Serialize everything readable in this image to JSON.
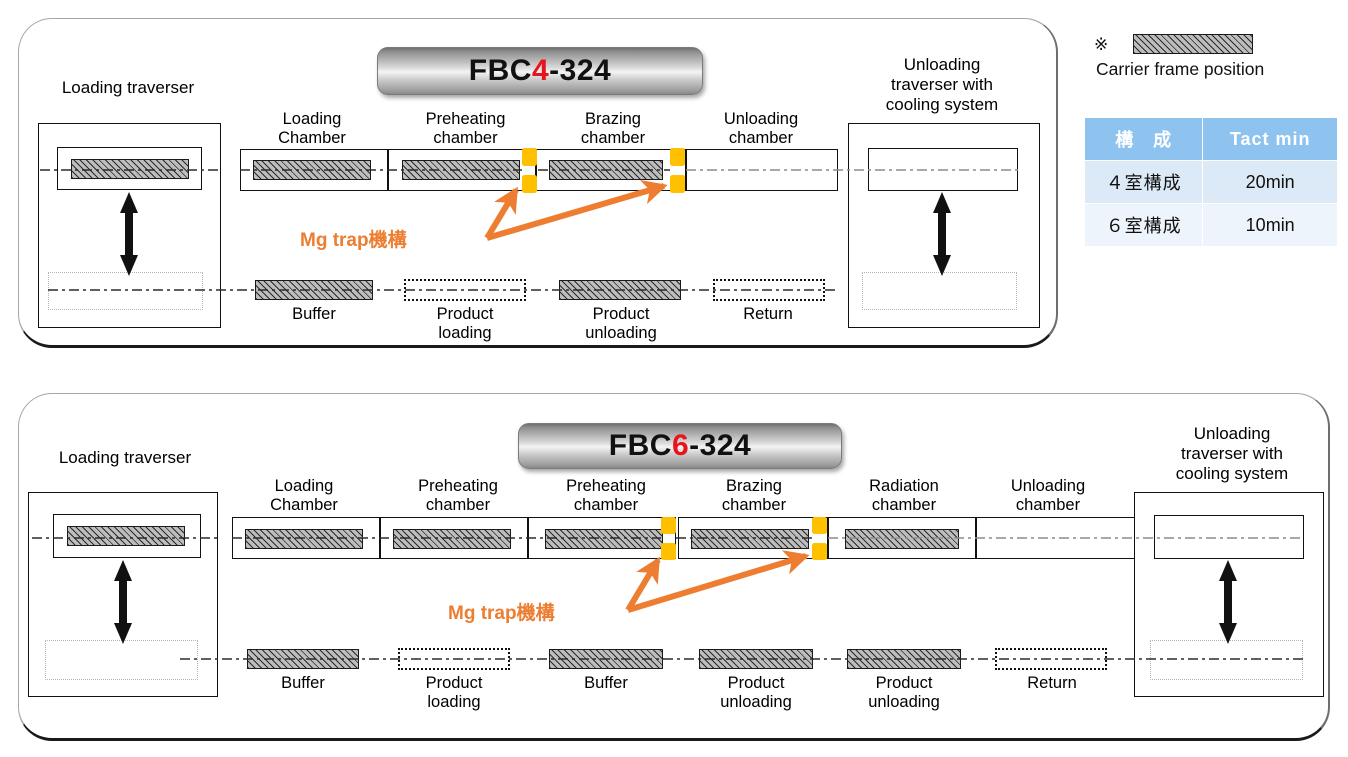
{
  "legend": {
    "mark": "※",
    "caption": "Carrier frame position"
  },
  "tact_table": {
    "headers": [
      "構　成",
      "Tact  min"
    ],
    "rows": [
      {
        "config": "４室構成",
        "tact": "20min"
      },
      {
        "config": "６室構成",
        "tact": "10min"
      }
    ]
  },
  "panels": [
    {
      "id": "fbc4",
      "title_prefix": "FBC",
      "title_number": "4",
      "title_suffix": "-324",
      "loading_traverser_label": "Loading traverser",
      "unloading_traverser_label": "Unloading\ntraverser with\ncooling system",
      "mg_trap_label": "Mg trap機構",
      "chambers": [
        {
          "label": "Loading\nChamber",
          "carrier": true
        },
        {
          "label": "Preheating\nchamber",
          "carrier": true
        },
        {
          "label": "Brazing\nchamber",
          "carrier": true
        },
        {
          "label": "Unloading\nchamber",
          "carrier": false
        }
      ],
      "lower_stations": [
        {
          "label": "Buffer",
          "carrier": true
        },
        {
          "label": "Product\nloading",
          "carrier": false
        },
        {
          "label": "Product\nunloading",
          "carrier": true
        },
        {
          "label": "Return",
          "carrier": false
        }
      ]
    },
    {
      "id": "fbc6",
      "title_prefix": "FBC",
      "title_number": "6",
      "title_suffix": "-324",
      "loading_traverser_label": "Loading traverser",
      "unloading_traverser_label": "Unloading\ntraverser with\ncooling system",
      "mg_trap_label": "Mg trap機構",
      "chambers": [
        {
          "label": "Loading\nChamber",
          "carrier": true
        },
        {
          "label": "Preheating\nchamber",
          "carrier": true
        },
        {
          "label": "Preheating\nchamber",
          "carrier": true
        },
        {
          "label": "Brazing\nchamber",
          "carrier": true
        },
        {
          "label": "Radiation\nchamber",
          "carrier": true
        },
        {
          "label": "Unloading\nchamber",
          "carrier": false
        }
      ],
      "lower_stations": [
        {
          "label": "Buffer",
          "carrier": true
        },
        {
          "label": "Product\nloading",
          "carrier": false
        },
        {
          "label": "Buffer",
          "carrier": true
        },
        {
          "label": "Product\nunloading",
          "carrier": true
        },
        {
          "label": "Product\nunloading",
          "carrier": true
        },
        {
          "label": "Return",
          "carrier": false
        }
      ]
    }
  ],
  "colors": {
    "accent_orange": "#ED7D31",
    "mg_trap_yellow": "#FFC000",
    "table_header": "#8EC3EF",
    "table_row_a": "#DCE9F7",
    "table_row_b": "#EEF4FB",
    "title_red": "#E8141B"
  }
}
